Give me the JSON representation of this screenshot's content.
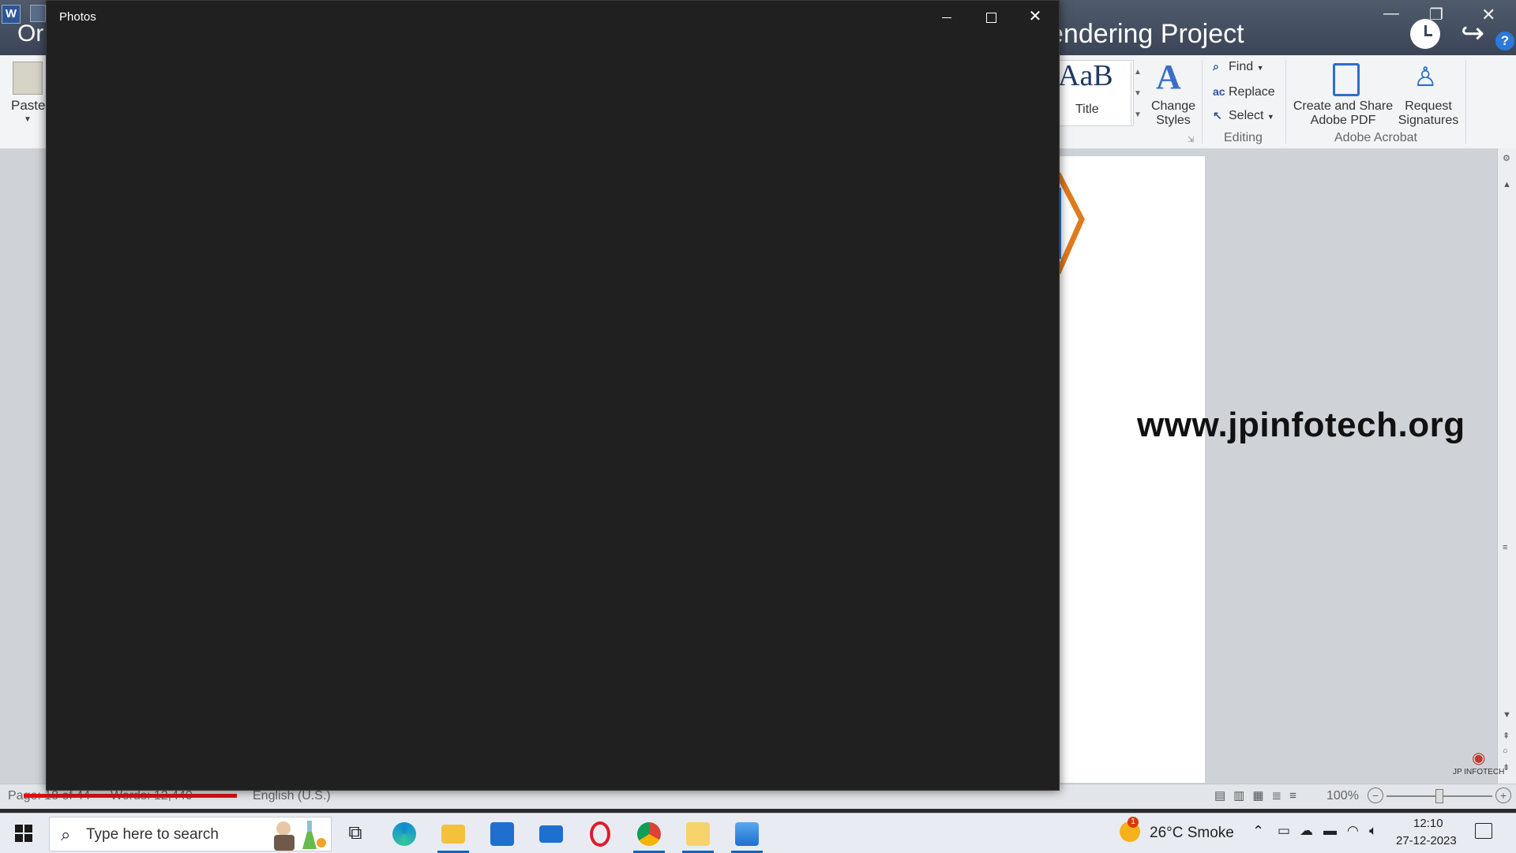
{
  "word": {
    "app_icon_letter": "W",
    "title_left": "Or",
    "title_right": "endering Project",
    "ribbon": {
      "paste_label": "Paste",
      "style_preview": "AaB",
      "style_name": "Title",
      "change_styles_label": "Change Styles",
      "editing": {
        "find": "Find",
        "replace": "Replace",
        "select": "Select",
        "group_label": "Editing"
      },
      "acrobat": {
        "create_share": "Create and Share Adobe PDF",
        "request_signatures": "Request Signatures",
        "group_label": "Adobe Acrobat"
      }
    },
    "document": {
      "url_text": "www.jpinfotech.org",
      "watermark_text": "JP INFOTECH"
    },
    "statusbar": {
      "page": "Page: 18 of 44",
      "words": "Words: 12,440",
      "language": "English (U.S.)",
      "zoom": "100%"
    }
  },
  "photos_window": {
    "title": "Photos",
    "controls": {
      "minimize": "minimize",
      "maximize": "maximize",
      "close": "✕"
    }
  },
  "taskbar": {
    "search_placeholder": "Type here to search",
    "weather": {
      "temp_condition": "26°C  Smoke",
      "badge": "1"
    },
    "clock": {
      "time": "12:10",
      "date": "27-12-2023"
    },
    "apps": [
      "task-view",
      "edge",
      "file-explorer",
      "microsoft-store",
      "mail",
      "opera",
      "chrome",
      "snipping-tool",
      "photos"
    ]
  },
  "colors": {
    "photos_bg": "#202020",
    "word_titlebar": "#4f5a6b",
    "taskbar_bg": "#e8ecf2",
    "accent": "#0a64c8"
  }
}
